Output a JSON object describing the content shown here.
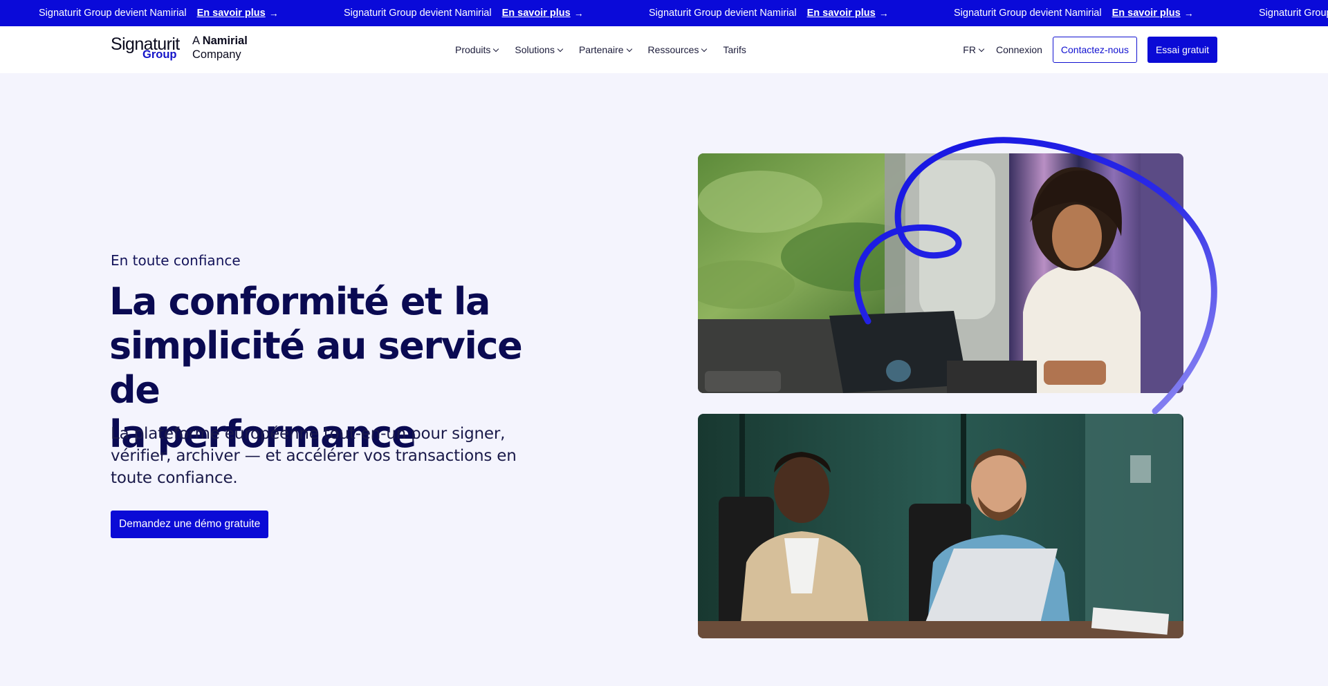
{
  "announcement": {
    "items": [
      {
        "text": "Signaturit Group devient Namirial",
        "link": "En savoir plus"
      },
      {
        "text": "Signaturit Group devient Namirial",
        "link": "En savoir plus"
      },
      {
        "text": "Signaturit Group devient Namirial",
        "link": "En savoir plus"
      },
      {
        "text": "Signaturit Group devient Namirial",
        "link": "En savoir plus"
      },
      {
        "text": "Signaturit Group devient Namirial",
        "link": ""
      }
    ],
    "arrow": "→"
  },
  "logo": {
    "main": "Signaturit",
    "group": "Group",
    "a": "A",
    "namirial": "Namirial",
    "company": "Company"
  },
  "nav": {
    "items": [
      {
        "label": "Produits",
        "has_dropdown": true
      },
      {
        "label": "Solutions",
        "has_dropdown": true
      },
      {
        "label": "Partenaire",
        "has_dropdown": true
      },
      {
        "label": "Ressources",
        "has_dropdown": true
      },
      {
        "label": "Tarifs",
        "has_dropdown": false
      }
    ],
    "lang": "FR",
    "login": "Connexion",
    "contact": "Contactez-nous",
    "trial": "Essai gratuit"
  },
  "hero": {
    "eyebrow": "En toute confiance",
    "headline_lines": [
      "La conformité et la",
      "simplicité au service de",
      "la performance"
    ],
    "subhead": "La plateforme européenne tout-en-un pour signer, vérifier, archiver — et accélérer vos transactions en toute confiance.",
    "cta": "Demandez une démo gratuite"
  },
  "colors": {
    "brand_blue": "#0b0bd6",
    "navy_text": "#0a0a52",
    "background": "#f4f4fd",
    "swirl_blue": "#1414e0",
    "swirl_violet": "#8a86f2"
  }
}
